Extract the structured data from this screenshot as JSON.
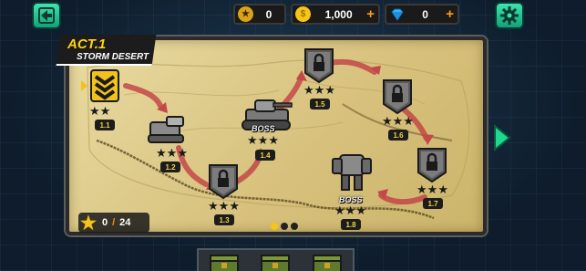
{
  "header": {
    "back_icon": "back-arrow-icon",
    "settings_icon": "gear-icon",
    "resources": {
      "medals": {
        "icon": "medal-icon",
        "value": "0"
      },
      "gold": {
        "icon": "coin-icon",
        "value": "1,000",
        "plus": "+"
      },
      "gems": {
        "icon": "diamond-icon",
        "value": "0",
        "plus": "+"
      }
    }
  },
  "act": {
    "title": "ACT.1",
    "subtitle": "STORM DESERT"
  },
  "nodes": [
    {
      "id": "1.1",
      "label": "1.1",
      "state": "current"
    },
    {
      "id": "1.2",
      "label": "1.2",
      "state": "unlocked"
    },
    {
      "id": "1.3",
      "label": "1.3",
      "state": "locked"
    },
    {
      "id": "1.4",
      "label": "1.4",
      "state": "boss",
      "boss": "BOSS"
    },
    {
      "id": "1.5",
      "label": "1.5",
      "state": "locked"
    },
    {
      "id": "1.6",
      "label": "1.6",
      "state": "locked"
    },
    {
      "id": "1.7",
      "label": "1.7",
      "state": "locked"
    },
    {
      "id": "1.8",
      "label": "1.8",
      "state": "boss",
      "boss": "BOSS"
    }
  ],
  "stars_progress": {
    "earned": "0",
    "separator": "/",
    "total": "24"
  },
  "pager": {
    "pages": 3,
    "active": 0
  },
  "colors": {
    "accent": "#1fc795",
    "gold": "#f5c518",
    "map": "#e3d196",
    "route": "#c94a4a"
  }
}
